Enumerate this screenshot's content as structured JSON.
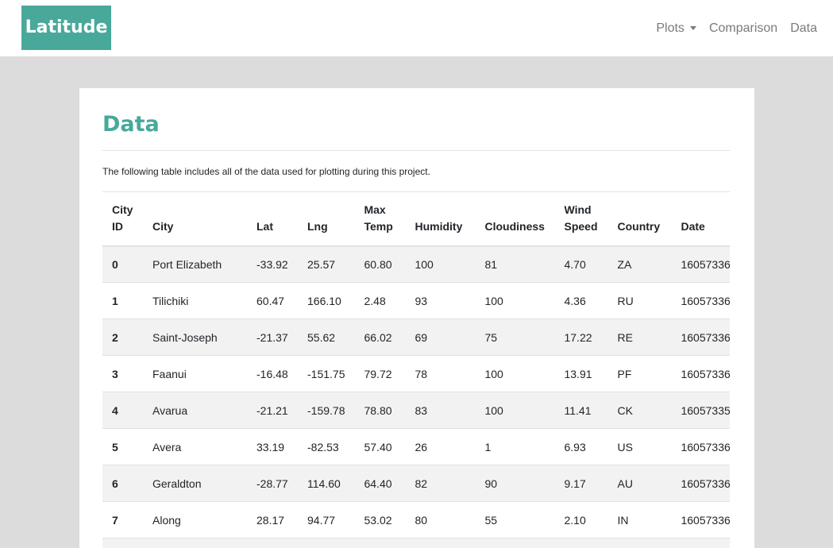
{
  "navbar": {
    "brand": "Latitude",
    "links": [
      "Plots",
      "Comparison",
      "Data"
    ]
  },
  "page": {
    "title": "Data",
    "intro": "The following table includes all of the data used for plotting during this project."
  },
  "table": {
    "headers": [
      [
        "City",
        "ID"
      ],
      [
        "City"
      ],
      [
        "Lat"
      ],
      [
        "Lng"
      ],
      [
        "Max",
        "Temp"
      ],
      [
        "Humidity"
      ],
      [
        "Cloudiness"
      ],
      [
        "Wind",
        "Speed"
      ],
      [
        "Country"
      ],
      [
        "Date"
      ]
    ],
    "rows": [
      [
        "0",
        "Port Elizabeth",
        "-33.92",
        "25.57",
        "60.80",
        "100",
        "81",
        "4.70",
        "ZA",
        "16057336"
      ],
      [
        "1",
        "Tilichiki",
        "60.47",
        "166.10",
        "2.48",
        "93",
        "100",
        "4.36",
        "RU",
        "16057336"
      ],
      [
        "2",
        "Saint-Joseph",
        "-21.37",
        "55.62",
        "66.02",
        "69",
        "75",
        "17.22",
        "RE",
        "16057336"
      ],
      [
        "3",
        "Faanui",
        "-16.48",
        "-151.75",
        "79.72",
        "78",
        "100",
        "13.91",
        "PF",
        "16057336"
      ],
      [
        "4",
        "Avarua",
        "-21.21",
        "-159.78",
        "78.80",
        "83",
        "100",
        "11.41",
        "CK",
        "16057335"
      ],
      [
        "5",
        "Avera",
        "33.19",
        "-82.53",
        "57.40",
        "26",
        "1",
        "6.93",
        "US",
        "16057336"
      ],
      [
        "6",
        "Geraldton",
        "-28.77",
        "114.60",
        "64.40",
        "82",
        "90",
        "9.17",
        "AU",
        "16057336"
      ],
      [
        "7",
        "Along",
        "28.17",
        "94.77",
        "53.02",
        "80",
        "55",
        "2.10",
        "IN",
        "16057336"
      ],
      [
        "",
        "",
        "",
        "",
        "",
        "",
        "",
        "",
        "",
        ""
      ]
    ]
  },
  "colors": {
    "brand": "#48a99a",
    "background": "#dcdcdc",
    "stripe": "#f2f2f2"
  }
}
